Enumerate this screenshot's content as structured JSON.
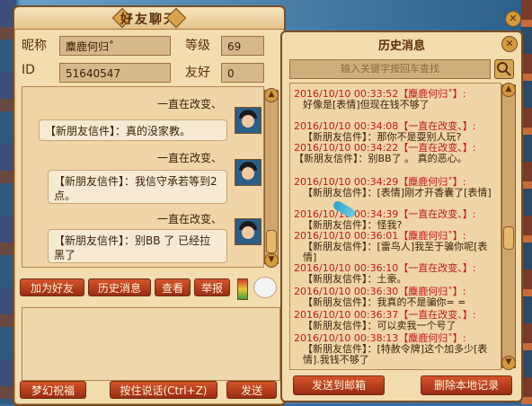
{
  "window_title": "好友聊天",
  "profile": {
    "nickname_label": "昵称",
    "nickname_value": "麋鹿何归˚",
    "level_label": "等级",
    "level_value": "69",
    "id_label": "ID",
    "id_value": "51640547",
    "friendship_label": "友好",
    "friendship_value": "0"
  },
  "chat": {
    "messages": [
      {
        "sender": "一直在改变、",
        "text": "【新朋友信件】：真的没家教。"
      },
      {
        "sender": "一直在改变、",
        "text": "【新朋友信件】：我信守承若等到2点。"
      },
      {
        "sender": "一直在改变、",
        "text": "【新朋友信件】：别BB 了 已经拉黑了"
      }
    ]
  },
  "action_buttons": {
    "add_friend": "加为好友",
    "history": "历史消息",
    "view": "查看",
    "report": "举报"
  },
  "bottom_buttons": {
    "blessing": "梦幻祝福",
    "push_to_talk": "按住说话(Ctrl+Z)",
    "send": "发送"
  },
  "history": {
    "title": "历史消息",
    "search_placeholder": "输入关键字按回车查找",
    "lines": [
      {
        "ts": "2016/10/10 00:33:52",
        "name": "【麋鹿何归˚】:",
        "msg": "好像是[表情]但现在钱不够了"
      },
      {
        "ts": "2016/10/10 00:34:08",
        "name": "【一直在改变、】:",
        "msg": "【新朋友信件】：那你不是耍别人玩?"
      },
      {
        "ts": "2016/10/10 00:34:22",
        "name": "【一直在改变、】:",
        "msg": "【新朋友信件】：别BB了 。 真的恶心。"
      },
      {
        "ts": "2016/10/10 00:34:29",
        "name": "【麋鹿何归˚】:",
        "msg": "【新朋友信件】：[表情]刚才开香囊了[表情]"
      },
      {
        "ts": "2016/10/10 00:34:39",
        "name": "【一直在改变、】:",
        "msg": "【新朋友信件】：怪我?"
      },
      {
        "ts": "2016/10/10 00:36:01",
        "name": "【麋鹿何归˚】:",
        "msg": "【新朋友信件】：[雷鸟人]我至于骗你呢[表情]"
      },
      {
        "ts": "2016/10/10 00:36:10",
        "name": "【一直在改变、】:",
        "msg": "【新朋友信件】：土豪。"
      },
      {
        "ts": "2016/10/10 00:36:30",
        "name": "【麋鹿何归˚】:",
        "msg": "【新朋友信件】：我真的不是骗你= ="
      },
      {
        "ts": "2016/10/10 00:36:37",
        "name": "【一直在改变、】:",
        "msg": "【新朋友信件】：可以卖我一个号了"
      },
      {
        "ts": "2016/10/10 00:38:13",
        "name": "【麋鹿何归˚】:",
        "msg": "【新朋友信件】：[特赦令牌]这个加多少[表情].我钱不够了"
      }
    ],
    "send_mail": "发送到邮箱",
    "delete_local": "删除本地记录"
  }
}
